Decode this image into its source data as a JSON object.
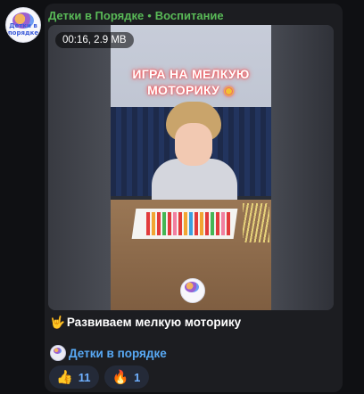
{
  "channel": {
    "name": "Детки в Порядке",
    "separator": "•",
    "topic": "Воспитание",
    "avatar_text": "Детки в порядке"
  },
  "video": {
    "duration": "00:16",
    "size": "2.9 MB",
    "overlay_title_line1": "ИГРА НА МЕЛКУЮ",
    "overlay_title_line2": "МОТОРИКУ",
    "overlay_emoji": "◉"
  },
  "message": {
    "caption_emoji": "🤟",
    "caption": "Развиваем мелкую моторику",
    "channel_link": "Детки в порядке"
  },
  "reactions": [
    {
      "icon": "👍",
      "count": "11"
    },
    {
      "icon": "🔥",
      "count": "1"
    }
  ],
  "colors": {
    "background": "#0f1013",
    "bubble": "#1c1d21",
    "author_green": "#59b957",
    "link_blue": "#58a9f5",
    "reaction_bg": "#242a38"
  }
}
